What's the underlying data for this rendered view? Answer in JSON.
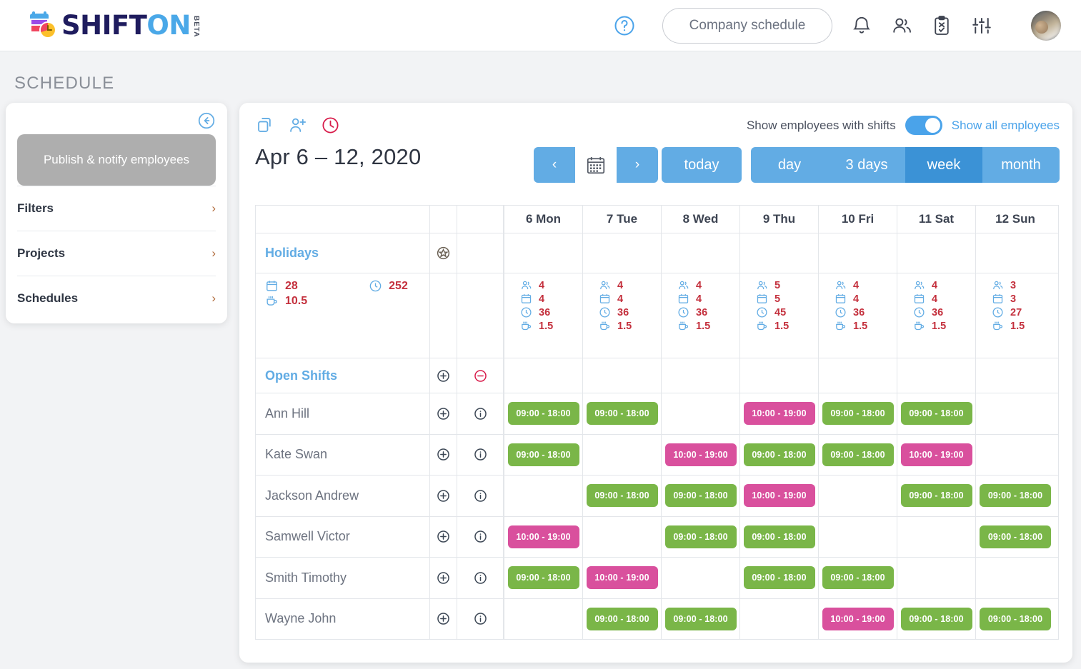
{
  "header": {
    "logo_shift": "SHIFT",
    "logo_on": "ON",
    "logo_beta": "BETA",
    "help_icon": "question-circle-icon",
    "company_button": "Company schedule",
    "icons": [
      "bell-icon",
      "people-icon",
      "clipboard-check-icon",
      "sliders-icon"
    ],
    "avatar": "user-avatar"
  },
  "page": {
    "title": "SCHEDULE"
  },
  "sidebar": {
    "collapse_icon": "collapse-left-icon",
    "publish_button": "Publish & notify employees",
    "items": [
      {
        "label": "Filters",
        "chevron": "chevron-right-icon"
      },
      {
        "label": "Projects",
        "chevron": "chevron-right-icon"
      },
      {
        "label": "Schedules",
        "chevron": "chevron-right-icon"
      }
    ]
  },
  "toolbar": {
    "icons": [
      "copy-icon",
      "add-person-icon",
      "clock-icon"
    ],
    "date_range": "Apr 6 – 12, 2020",
    "prev": "‹",
    "next": "›",
    "calendar_icon": "calendar-icon",
    "today": "today",
    "views": [
      {
        "label": "day",
        "active": false
      },
      {
        "label": "3 days",
        "active": false
      },
      {
        "label": "week",
        "active": true
      },
      {
        "label": "month",
        "active": false
      }
    ],
    "toggle_left_label": "Show employees with shifts",
    "toggle_right_label": "Show all employees",
    "toggle_on": true
  },
  "colors": {
    "accent_blue": "#62ace4",
    "accent_blue_active": "#3b92d6",
    "shift_green": "#7ab648",
    "shift_pink": "#d9509d",
    "stat_red": "#c4303d",
    "link_blue": "#62ace4"
  },
  "grid": {
    "day_headers": [
      "6 Mon",
      "7 Tue",
      "8 Wed",
      "9 Thu",
      "10 Fri",
      "11 Sat",
      "12 Sun"
    ],
    "holidays_label": "Holidays",
    "holidays_icon": "star-circle-icon",
    "open_shifts_label": "Open Shifts",
    "totals": {
      "shifts": "28",
      "hours": "252",
      "breaks": "10.5"
    },
    "day_stats": [
      {
        "employees": "4",
        "shifts": "4",
        "hours": "36",
        "breaks": "1.5"
      },
      {
        "employees": "4",
        "shifts": "4",
        "hours": "36",
        "breaks": "1.5"
      },
      {
        "employees": "4",
        "shifts": "4",
        "hours": "36",
        "breaks": "1.5"
      },
      {
        "employees": "5",
        "shifts": "5",
        "hours": "45",
        "breaks": "1.5"
      },
      {
        "employees": "4",
        "shifts": "4",
        "hours": "36",
        "breaks": "1.5"
      },
      {
        "employees": "4",
        "shifts": "4",
        "hours": "36",
        "breaks": "1.5"
      },
      {
        "employees": "3",
        "shifts": "3",
        "hours": "27",
        "breaks": "1.5"
      }
    ],
    "shift_labels": {
      "day": "09:00 - 18:00",
      "late": "10:00 - 19:00"
    },
    "employees": [
      {
        "name": "Ann Hill",
        "shifts": [
          "09:00 - 18:00",
          "09:00 - 18:00",
          "",
          "10:00 - 19:00",
          "09:00 - 18:00",
          "09:00 - 18:00",
          ""
        ],
        "types": [
          "green",
          "green",
          "",
          "pink",
          "green",
          "green",
          ""
        ]
      },
      {
        "name": "Kate Swan",
        "shifts": [
          "09:00 - 18:00",
          "",
          "10:00 - 19:00",
          "09:00 - 18:00",
          "09:00 - 18:00",
          "10:00 - 19:00",
          ""
        ],
        "types": [
          "green",
          "",
          "pink",
          "green",
          "green",
          "pink",
          ""
        ]
      },
      {
        "name": "Jackson Andrew",
        "shifts": [
          "",
          "09:00 - 18:00",
          "09:00 - 18:00",
          "10:00 - 19:00",
          "",
          "09:00 - 18:00",
          "09:00 - 18:00"
        ],
        "types": [
          "",
          "green",
          "green",
          "pink",
          "",
          "green",
          "green"
        ]
      },
      {
        "name": "Samwell Victor",
        "shifts": [
          "10:00 - 19:00",
          "",
          "09:00 - 18:00",
          "09:00 - 18:00",
          "",
          "",
          "09:00 - 18:00"
        ],
        "types": [
          "pink",
          "",
          "green",
          "green",
          "",
          "",
          "green"
        ]
      },
      {
        "name": "Smith Timothy",
        "shifts": [
          "09:00 - 18:00",
          "10:00 - 19:00",
          "",
          "09:00 - 18:00",
          "09:00 - 18:00",
          "",
          ""
        ],
        "types": [
          "green",
          "pink",
          "",
          "green",
          "green",
          "",
          ""
        ]
      },
      {
        "name": "Wayne John",
        "shifts": [
          "",
          "09:00 - 18:00",
          "09:00 - 18:00",
          "",
          "10:00 - 19:00",
          "09:00 - 18:00",
          "09:00 - 18:00"
        ],
        "types": [
          "",
          "green",
          "green",
          "",
          "pink",
          "green",
          "green"
        ]
      }
    ],
    "row_icons": {
      "add": "plus-circle-icon",
      "info": "info-circle-icon",
      "remove": "minus-circle-icon"
    }
  }
}
